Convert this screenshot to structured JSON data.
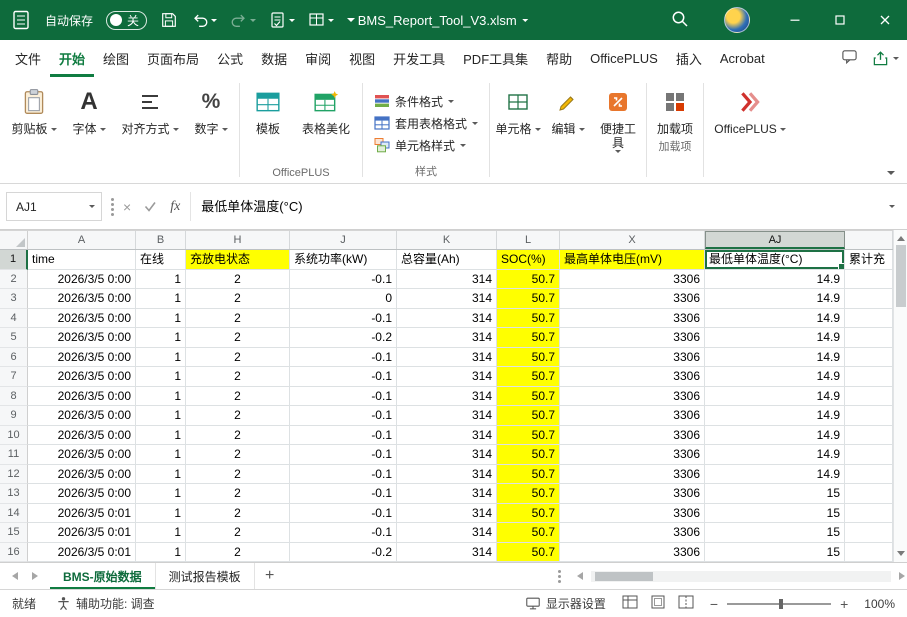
{
  "colors": {
    "titlebar_green": "#0E6B3C",
    "accent_green": "#107C41",
    "selection_green": "#1E7145",
    "highlight_yellow": "#FFFF00"
  },
  "icons": {
    "autosave_toggle": "switch-off-pill",
    "save": "floppy-disk",
    "undo": "curved-arrow-left",
    "redo": "curved-arrow-right",
    "search": "magnifier",
    "close": "x-cross",
    "maximize": "square-outline",
    "minimize": "horizontal-bar",
    "new_sheet": "plus",
    "collapse_ribbon": "chevron-down"
  },
  "title_bar": {
    "autosave_label": "自动保存",
    "autosave_state": "关",
    "document_title": "BMS_Report_Tool_V3.xlsm"
  },
  "ribbon_tabs": [
    {
      "label": "文件",
      "active": false
    },
    {
      "label": "开始",
      "active": true
    },
    {
      "label": "绘图",
      "active": false
    },
    {
      "label": "页面布局",
      "active": false
    },
    {
      "label": "公式",
      "active": false
    },
    {
      "label": "数据",
      "active": false
    },
    {
      "label": "审阅",
      "active": false
    },
    {
      "label": "视图",
      "active": false
    },
    {
      "label": "开发工具",
      "active": false
    },
    {
      "label": "PDF工具集",
      "active": false
    },
    {
      "label": "帮助",
      "active": false
    },
    {
      "label": "OfficePLUS",
      "active": false
    },
    {
      "label": "插入",
      "active": false
    },
    {
      "label": "Acrobat",
      "active": false
    }
  ],
  "ribbon": {
    "clipboard": "剪贴板",
    "font": "字体",
    "alignment": "对齐方式",
    "number": "数字",
    "template": "模板",
    "beautify": "表格美化",
    "officeplus_group": "OfficePLUS",
    "conditional": "条件格式",
    "format_table": "套用表格格式",
    "cell_styles": "单元格样式",
    "styles_group": "样式",
    "cells": "单元格",
    "editing": "编辑",
    "tools": "便捷工具",
    "addins": "加载项",
    "addins_group": "加载项",
    "officeplus_btn": "OfficePLUS"
  },
  "formula_bar": {
    "name_box": "AJ1",
    "fx": "fx",
    "value": "最低单体温度(°C)"
  },
  "grid": {
    "columns": [
      {
        "letter": "A",
        "header": "time"
      },
      {
        "letter": "B",
        "header": "在线"
      },
      {
        "letter": "H",
        "header": "充放电状态"
      },
      {
        "letter": "J",
        "header": "系统功率(kW)"
      },
      {
        "letter": "K",
        "header": "总容量(Ah)"
      },
      {
        "letter": "L",
        "header": "SOC(%)"
      },
      {
        "letter": "X",
        "header": "最高单体电压(mV)"
      },
      {
        "letter": "AJ",
        "header": "最低单体温度(°C)"
      },
      {
        "letter": "",
        "header": "累计充"
      }
    ],
    "rows": [
      {
        "num": 2,
        "cells": [
          "2026/3/5 0:00",
          "1",
          "2",
          "-0.1",
          "314",
          "50.7",
          "3306",
          "14.9",
          ""
        ]
      },
      {
        "num": 3,
        "cells": [
          "2026/3/5 0:00",
          "1",
          "2",
          "0",
          "314",
          "50.7",
          "3306",
          "14.9",
          ""
        ]
      },
      {
        "num": 4,
        "cells": [
          "2026/3/5 0:00",
          "1",
          "2",
          "-0.1",
          "314",
          "50.7",
          "3306",
          "14.9",
          ""
        ]
      },
      {
        "num": 5,
        "cells": [
          "2026/3/5 0:00",
          "1",
          "2",
          "-0.2",
          "314",
          "50.7",
          "3306",
          "14.9",
          ""
        ]
      },
      {
        "num": 6,
        "cells": [
          "2026/3/5 0:00",
          "1",
          "2",
          "-0.1",
          "314",
          "50.7",
          "3306",
          "14.9",
          ""
        ]
      },
      {
        "num": 7,
        "cells": [
          "2026/3/5 0:00",
          "1",
          "2",
          "-0.1",
          "314",
          "50.7",
          "3306",
          "14.9",
          ""
        ]
      },
      {
        "num": 8,
        "cells": [
          "2026/3/5 0:00",
          "1",
          "2",
          "-0.1",
          "314",
          "50.7",
          "3306",
          "14.9",
          ""
        ]
      },
      {
        "num": 9,
        "cells": [
          "2026/3/5 0:00",
          "1",
          "2",
          "-0.1",
          "314",
          "50.7",
          "3306",
          "14.9",
          ""
        ]
      },
      {
        "num": 10,
        "cells": [
          "2026/3/5 0:00",
          "1",
          "2",
          "-0.1",
          "314",
          "50.7",
          "3306",
          "14.9",
          ""
        ]
      },
      {
        "num": 11,
        "cells": [
          "2026/3/5 0:00",
          "1",
          "2",
          "-0.1",
          "314",
          "50.7",
          "3306",
          "14.9",
          ""
        ]
      },
      {
        "num": 12,
        "cells": [
          "2026/3/5 0:00",
          "1",
          "2",
          "-0.1",
          "314",
          "50.7",
          "3306",
          "14.9",
          ""
        ]
      },
      {
        "num": 13,
        "cells": [
          "2026/3/5 0:00",
          "1",
          "2",
          "-0.1",
          "314",
          "50.7",
          "3306",
          "15",
          ""
        ]
      },
      {
        "num": 14,
        "cells": [
          "2026/3/5 0:01",
          "1",
          "2",
          "-0.1",
          "314",
          "50.7",
          "3306",
          "15",
          ""
        ]
      },
      {
        "num": 15,
        "cells": [
          "2026/3/5 0:01",
          "1",
          "2",
          "-0.1",
          "314",
          "50.7",
          "3306",
          "15",
          ""
        ]
      },
      {
        "num": 16,
        "cells": [
          "2026/3/5 0:01",
          "1",
          "2",
          "-0.2",
          "314",
          "50.7",
          "3306",
          "15",
          ""
        ]
      }
    ]
  },
  "sheet_tabs": {
    "tabs": [
      {
        "label": "BMS-原始数据",
        "active": true
      },
      {
        "label": "测试报告模板",
        "active": false
      }
    ],
    "new_sheet_label": "+"
  },
  "status_bar": {
    "ready": "就绪",
    "accessibility": "辅助功能: 调查",
    "display_settings": "显示器设置",
    "zoom_level": "100%"
  }
}
